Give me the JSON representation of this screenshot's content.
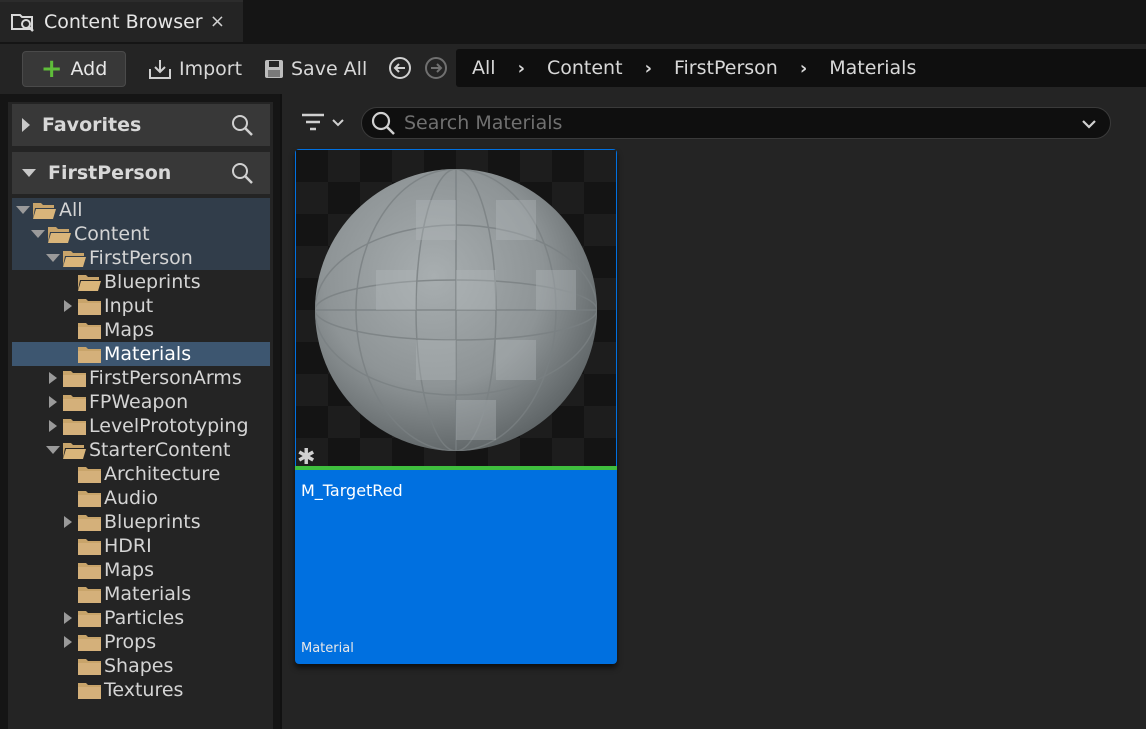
{
  "tab": {
    "title": "Content Browser",
    "icon": "content-browser-icon",
    "close": "×"
  },
  "toolbar": {
    "add_label": "Add",
    "import_label": "Import",
    "save_all_label": "Save All",
    "breadcrumb": [
      "All",
      "Content",
      "FirstPerson",
      "Materials"
    ]
  },
  "sidebar": {
    "favorites_label": "Favorites",
    "project_label": "FirstPerson",
    "tree": [
      {
        "label": "All",
        "depth": 0,
        "expander": "open",
        "folder": "open",
        "state": "hl"
      },
      {
        "label": "Content",
        "depth": 1,
        "expander": "open",
        "folder": "open",
        "state": "hl"
      },
      {
        "label": "FirstPerson",
        "depth": 2,
        "expander": "open",
        "folder": "open",
        "state": "hl"
      },
      {
        "label": "Blueprints",
        "depth": 3,
        "expander": "none",
        "folder": "open",
        "state": ""
      },
      {
        "label": "Input",
        "depth": 3,
        "expander": "closed",
        "folder": "closed",
        "state": ""
      },
      {
        "label": "Maps",
        "depth": 3,
        "expander": "none",
        "folder": "closed",
        "state": ""
      },
      {
        "label": "Materials",
        "depth": 3,
        "expander": "none",
        "folder": "closed",
        "state": "sel"
      },
      {
        "label": "FirstPersonArms",
        "depth": 2,
        "expander": "closed",
        "folder": "closed",
        "state": ""
      },
      {
        "label": "FPWeapon",
        "depth": 2,
        "expander": "closed",
        "folder": "closed",
        "state": ""
      },
      {
        "label": "LevelPrototyping",
        "depth": 2,
        "expander": "closed",
        "folder": "closed",
        "state": ""
      },
      {
        "label": "StarterContent",
        "depth": 2,
        "expander": "open",
        "folder": "open",
        "state": ""
      },
      {
        "label": "Architecture",
        "depth": 3,
        "expander": "none",
        "folder": "closed",
        "state": ""
      },
      {
        "label": "Audio",
        "depth": 3,
        "expander": "none",
        "folder": "closed",
        "state": ""
      },
      {
        "label": "Blueprints",
        "depth": 3,
        "expander": "closed",
        "folder": "closed",
        "state": ""
      },
      {
        "label": "HDRI",
        "depth": 3,
        "expander": "none",
        "folder": "closed",
        "state": ""
      },
      {
        "label": "Maps",
        "depth": 3,
        "expander": "none",
        "folder": "closed",
        "state": ""
      },
      {
        "label": "Materials",
        "depth": 3,
        "expander": "none",
        "folder": "closed",
        "state": ""
      },
      {
        "label": "Particles",
        "depth": 3,
        "expander": "closed",
        "folder": "closed",
        "state": ""
      },
      {
        "label": "Props",
        "depth": 3,
        "expander": "closed",
        "folder": "closed",
        "state": ""
      },
      {
        "label": "Shapes",
        "depth": 3,
        "expander": "none",
        "folder": "closed",
        "state": ""
      },
      {
        "label": "Textures",
        "depth": 3,
        "expander": "none",
        "folder": "closed",
        "state": ""
      }
    ]
  },
  "search": {
    "placeholder": "Search Materials",
    "value": ""
  },
  "assets": [
    {
      "name": "M_TargetRed",
      "type": "Material"
    }
  ],
  "colors": {
    "folder": "#c8a46a",
    "selection": "#0070e0",
    "asset_bar": "#3fbf3f",
    "add_plus": "#5fbd3a"
  }
}
